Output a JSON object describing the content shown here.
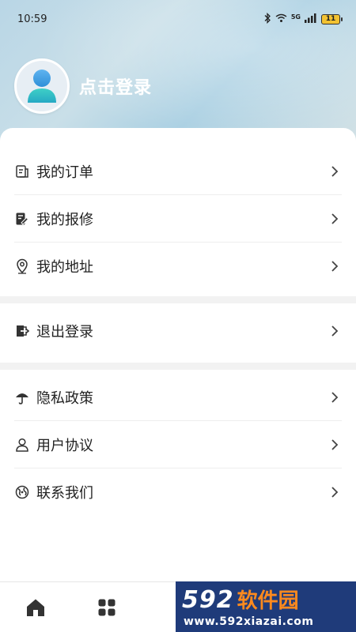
{
  "status_bar": {
    "time": "10:59",
    "network": "5G",
    "battery": "11"
  },
  "profile": {
    "login_label": "点击登录"
  },
  "menu": {
    "group1": [
      {
        "label": "我的订单",
        "icon": "order-icon"
      },
      {
        "label": "我的报修",
        "icon": "repair-icon"
      },
      {
        "label": "我的地址",
        "icon": "location-icon"
      }
    ],
    "group2": [
      {
        "label": "退出登录",
        "icon": "logout-icon"
      }
    ],
    "group3": [
      {
        "label": "隐私政策",
        "icon": "umbrella-icon"
      },
      {
        "label": "用户协议",
        "icon": "user-icon"
      },
      {
        "label": "联系我们",
        "icon": "globe-icon"
      }
    ]
  },
  "bottom_nav": [
    {
      "icon": "home-icon"
    },
    {
      "icon": "grid-icon"
    }
  ],
  "watermark": {
    "brand_num": "592",
    "brand_cn": "软件园",
    "url": "www.592xiazai.com"
  },
  "colors": {
    "accent": "#4a90c8",
    "watermark_bg": "#1f3b7a",
    "watermark_cn": "#ff8a1e"
  }
}
